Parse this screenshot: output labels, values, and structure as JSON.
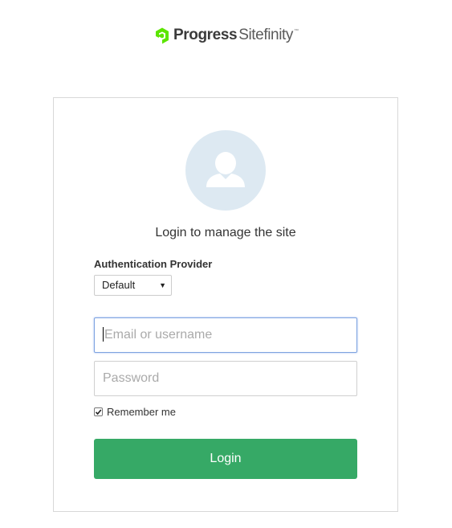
{
  "brand": {
    "company": "Progress",
    "product": "Sitefinity",
    "trademark": "™",
    "mark_color": "#5ce500"
  },
  "login": {
    "title": "Login to manage the site",
    "auth_provider_label": "Authentication Provider",
    "auth_provider_selected": "Default",
    "email_placeholder": "Email or username",
    "password_placeholder": "Password",
    "remember_label": "Remember me",
    "remember_checked": true,
    "button_label": "Login",
    "button_color": "#36a966"
  }
}
